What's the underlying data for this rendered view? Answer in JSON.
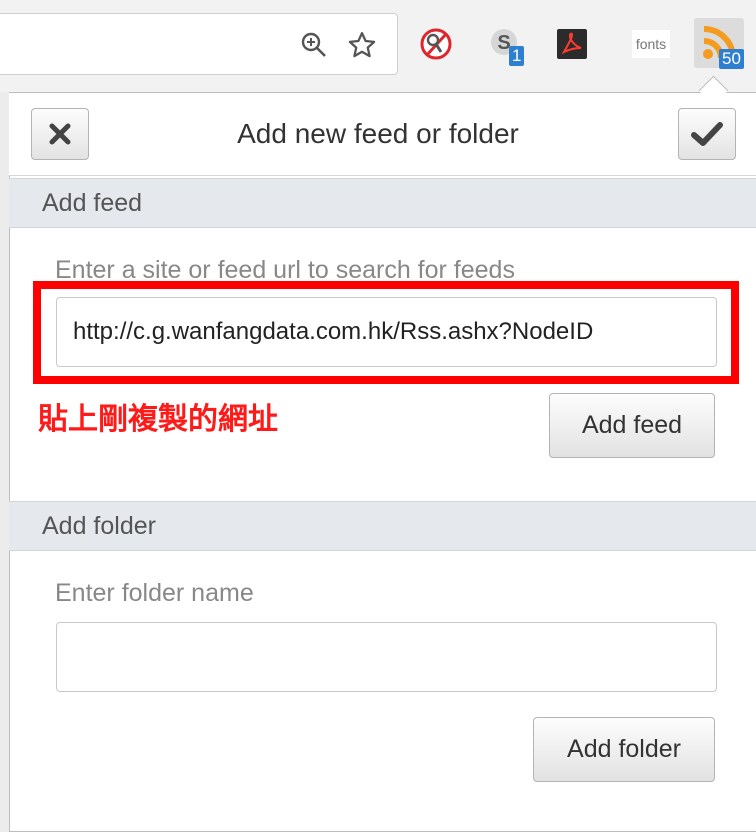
{
  "toolbar": {
    "extensions": [
      {
        "name": "Extension with magnifier logo"
      },
      {
        "name": "Skype",
        "badge": "1"
      },
      {
        "name": "Adobe Acrobat"
      },
      {
        "name": "fonts",
        "label": "fonts"
      },
      {
        "name": "RSS Feed Reader",
        "badge": "50"
      }
    ]
  },
  "popup": {
    "title": "Add new feed or folder",
    "feed": {
      "section_title": "Add feed",
      "label": "Enter a site or feed url to search for feeds",
      "url_value": "http://c.g.wanfangdata.com.hk/Rss.ashx?NodeID",
      "button": "Add feed",
      "annotation": "貼上剛複製的網址"
    },
    "folder": {
      "section_title": "Add folder",
      "label": "Enter folder name",
      "value": "",
      "button": "Add folder"
    }
  },
  "colors": {
    "annotation_red": "#ff0000",
    "section_bg": "#e5e9ee",
    "rss_orange": "#f59b1e",
    "badge_blue": "#2f7fd0"
  }
}
